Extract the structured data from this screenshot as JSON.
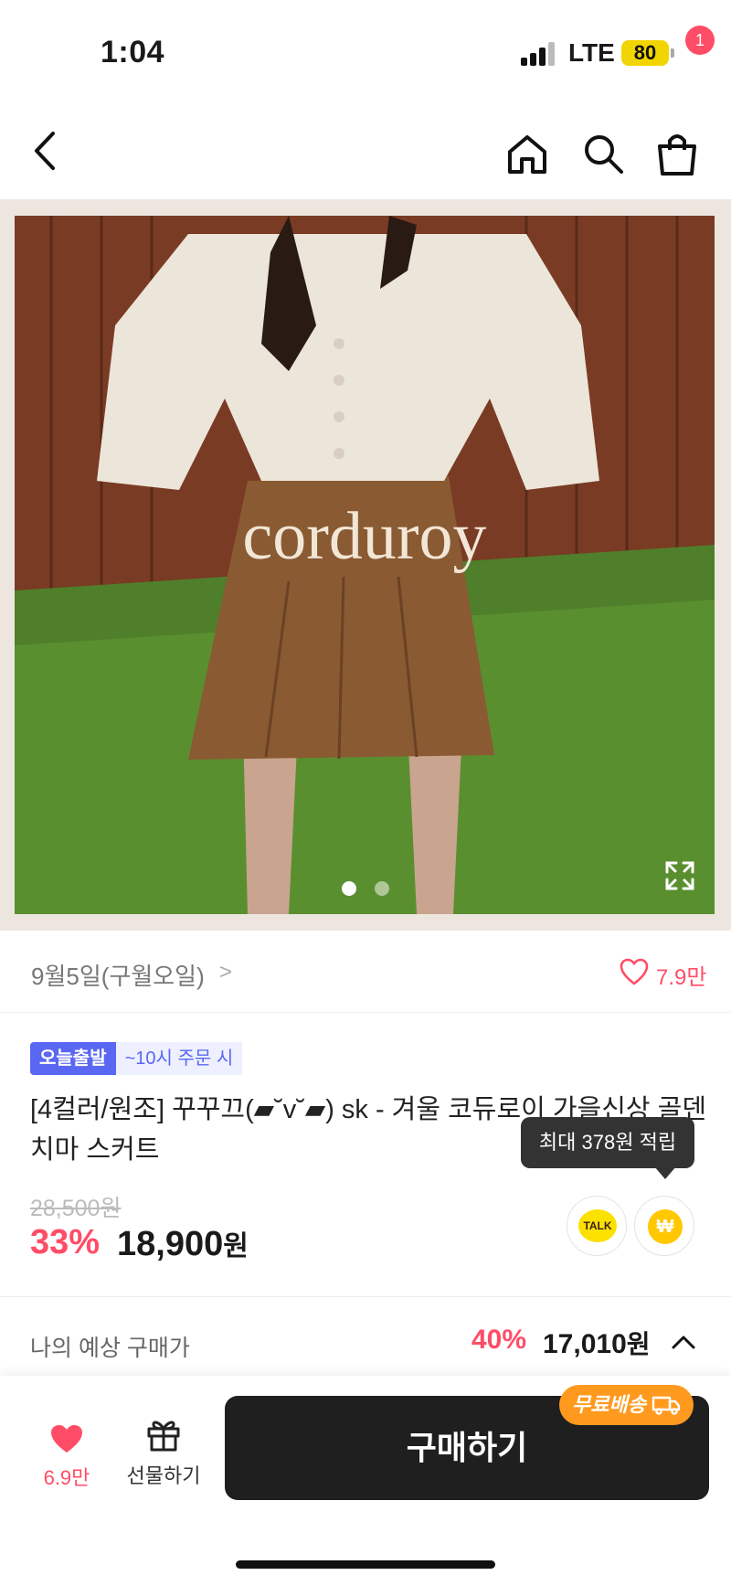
{
  "status_bar": {
    "time": "1:04",
    "network": "LTE",
    "battery": "80"
  },
  "nav": {
    "cart_count": "1"
  },
  "hero": {
    "overlay_text": "corduroy",
    "page_count": 2,
    "current_page": 1
  },
  "brand": {
    "name": "9월5일(구월오일)",
    "chevron": ">",
    "like_count": "7.9만"
  },
  "badges": {
    "today_ship": "오늘출발",
    "cutoff": "~10시 주문 시"
  },
  "product": {
    "title": "[4컬러/원조] 꾸꾸끄(▰˘v˘▰) sk - 겨울 코듀로이 가을신상 골덴 치마 스커트",
    "original_price": "28,500원",
    "discount": "33%",
    "sale_price": "18,900",
    "price_unit": "원"
  },
  "tooltip": {
    "text": "최대 378원 적립"
  },
  "buttons": {
    "talk_label": "TALK",
    "point_label": "₩"
  },
  "expected": {
    "label": "나의 예상 구매가",
    "discount": "40%",
    "price": "17,010",
    "unit": "원"
  },
  "bottom": {
    "wish_count": "6.9만",
    "gift_label": "선물하기",
    "buy_label": "구매하기",
    "free_ship": "무료배송"
  },
  "colors": {
    "accent_pink": "#ff4d67",
    "badge_blue": "#5a67f2",
    "kakao_yellow": "#fae100",
    "ship_orange": "#ff9a1f"
  }
}
